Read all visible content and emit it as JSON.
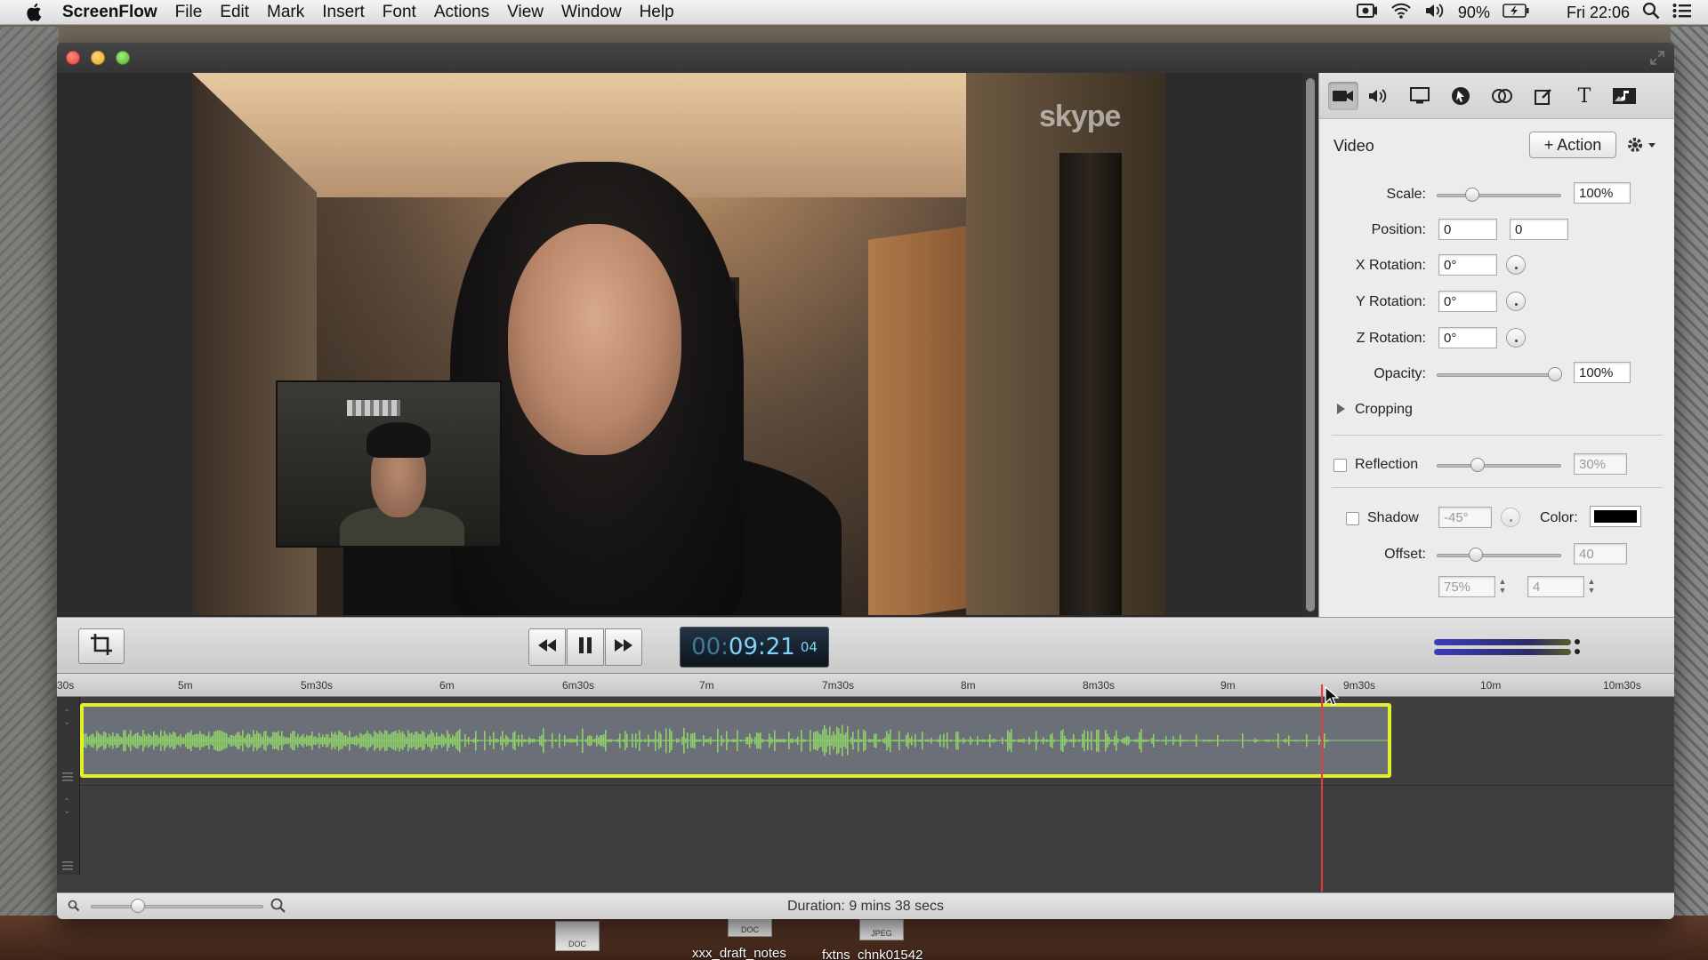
{
  "menubar": {
    "app_name": "ScreenFlow",
    "items": [
      "File",
      "Edit",
      "Mark",
      "Insert",
      "Font",
      "Actions",
      "View",
      "Window",
      "Help"
    ],
    "battery": "90%",
    "clock": "Fri 22:06"
  },
  "inspector": {
    "tabs": [
      "video-icon",
      "audio-icon",
      "screen-icon",
      "callout-icon",
      "annotation-icon",
      "touch-icon",
      "text-icon",
      "media-icon"
    ],
    "section_title": "Video",
    "action_button": "+ Action",
    "scale_label": "Scale:",
    "scale_value": "100%",
    "scale_fraction": 0.25,
    "position_label": "Position:",
    "position_x": "0",
    "position_y": "0",
    "x_rotation_label": "X Rotation:",
    "x_rotation": "0°",
    "y_rotation_label": "Y Rotation:",
    "y_rotation": "0°",
    "z_rotation_label": "Z Rotation:",
    "z_rotation": "0°",
    "opacity_label": "Opacity:",
    "opacity_value": "100%",
    "opacity_fraction": 1.0,
    "cropping_label": "Cropping",
    "reflection_label": "Reflection",
    "reflection_value": "30%",
    "reflection_fraction": 0.3,
    "shadow_label": "Shadow",
    "shadow_angle": "-45°",
    "color_label": "Color:",
    "shadow_color": "#000000",
    "offset_label": "Offset:",
    "offset_value": "40",
    "offset_fraction": 0.28,
    "opacity2_value": "75%",
    "blur_value": "4"
  },
  "video": {
    "watermark": "skype"
  },
  "transport": {
    "timecode_prefix": "00:",
    "timecode_main": "09:21",
    "timecode_frames": "04"
  },
  "timeline": {
    "ruler": [
      "30s",
      "5m",
      "5m30s",
      "6m",
      "6m30s",
      "7m",
      "7m30s",
      "8m",
      "8m30s",
      "9m",
      "9m30s",
      "10m",
      "10m30s"
    ],
    "playhead_time": "9m21s"
  },
  "status": {
    "duration": "Duration: 9 mins 38 secs"
  },
  "desktop": {
    "icons": [
      {
        "type": "DOC",
        "label": "xxx_draft_notes"
      },
      {
        "type": "DOC",
        "label": ""
      },
      {
        "type": "JPEG",
        "label": "fxtns_chnk01542"
      }
    ]
  },
  "colors": {
    "clip_border": "#e4f028",
    "waveform": "#8fcf6a",
    "playhead": "#e83a3a",
    "timecode": "#7fd3f5"
  }
}
